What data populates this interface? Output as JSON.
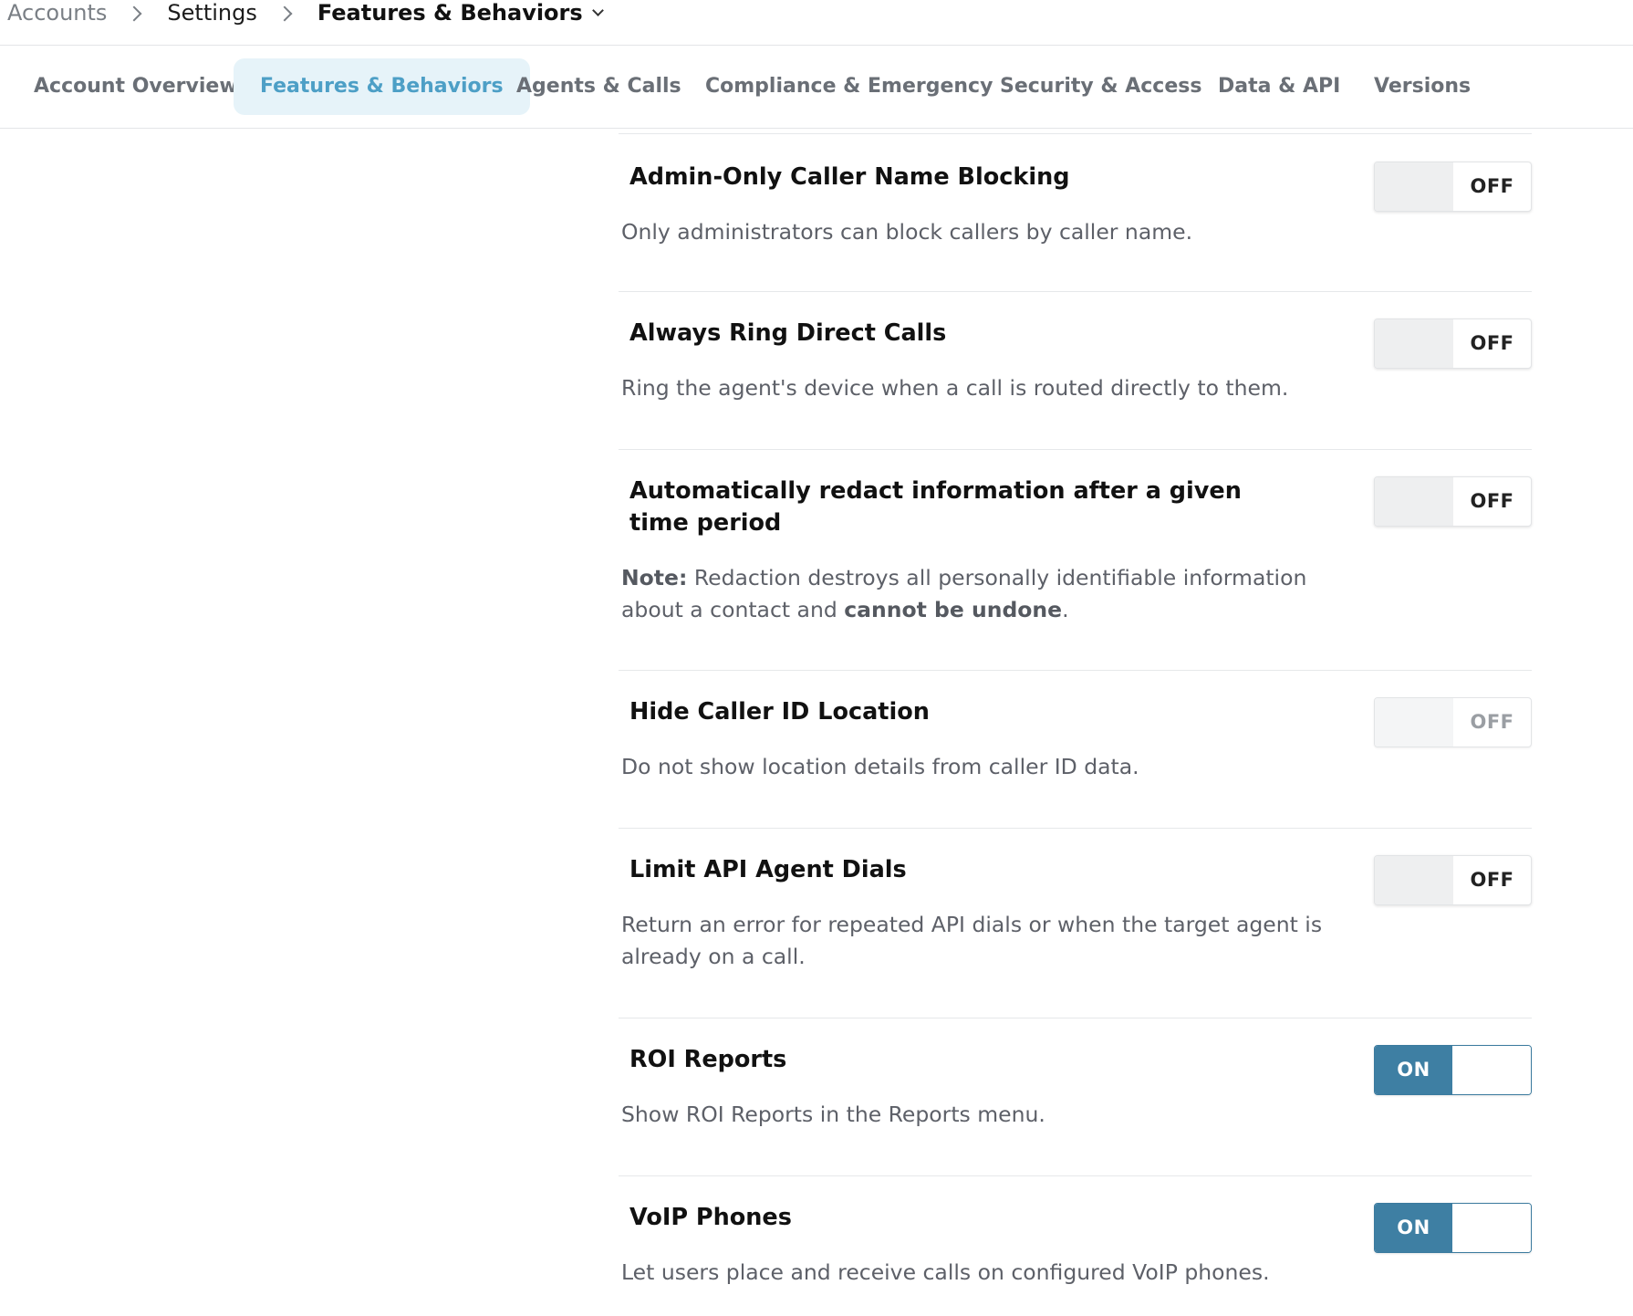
{
  "breadcrumb": {
    "accounts": "Accounts",
    "settings": "Settings",
    "current": "Features & Behaviors"
  },
  "tabs": [
    {
      "label": "Account Overview",
      "active": false
    },
    {
      "label": "Features & Behaviors",
      "active": true
    },
    {
      "label": "Agents & Calls",
      "active": false
    },
    {
      "label": "Compliance & Emergency",
      "active": false
    },
    {
      "label": "Security & Access",
      "active": false
    },
    {
      "label": "Data & API",
      "active": false
    },
    {
      "label": "Versions",
      "active": false
    }
  ],
  "settings": [
    {
      "title": "Admin-Only Caller Name Blocking",
      "description": "Only administrators can block callers by caller name.",
      "toggle": "OFF",
      "enabled": false
    },
    {
      "title": "Always Ring Direct Calls",
      "description": "Ring the agent's device when a call is routed directly to them.",
      "toggle": "OFF",
      "enabled": false
    },
    {
      "title": "Automatically redact information after a given time period",
      "note_label": "Note:",
      "note_text": " Redaction destroys all personally identifiable information about a contact and ",
      "note_bold": "cannot be undone",
      "note_end": ".",
      "toggle": "OFF",
      "enabled": false
    },
    {
      "title": "Hide Caller ID Location",
      "description": "Do not show location details from caller ID data.",
      "toggle": "OFF",
      "enabled": false,
      "disabled": true
    },
    {
      "title": "Limit API Agent Dials",
      "description": "Return an error for repeated API dials or when the target agent is already on a call.",
      "toggle": "OFF",
      "enabled": false
    },
    {
      "title": "ROI Reports",
      "description": "Show ROI Reports in the Reports menu.",
      "toggle": "ON",
      "enabled": true
    },
    {
      "title": "VoIP Phones",
      "description": "Let users place and receive calls on configured VoIP phones.",
      "toggle": "ON",
      "enabled": true
    }
  ],
  "colors": {
    "accent": "#4d9fc6",
    "active_tab_bg": "#e6f3f9",
    "toggle_on": "#3e7fa3"
  }
}
